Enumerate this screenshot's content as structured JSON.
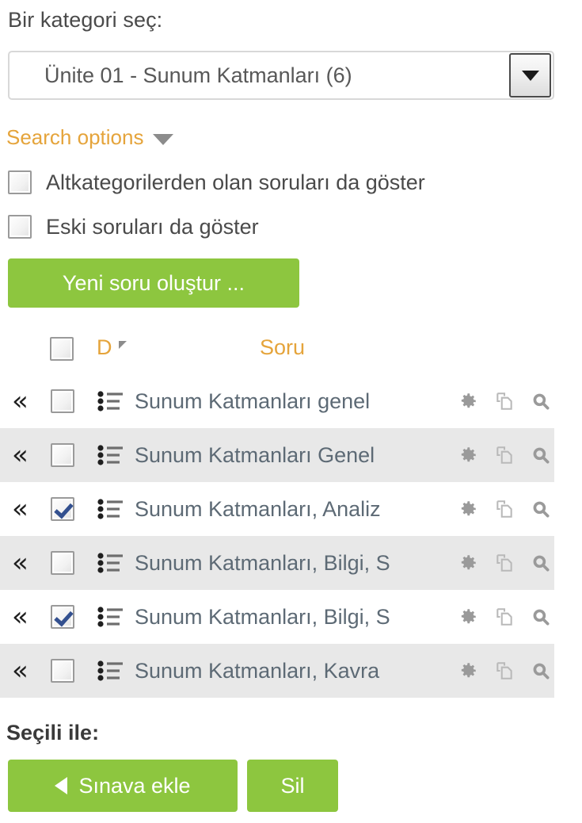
{
  "category": {
    "label": "Bir kategori seç:",
    "selected": "Ünite 01 - Sunum Katmanları (6)"
  },
  "search_options": {
    "label": "Search options",
    "caret_icon": "chevron-down-icon"
  },
  "options": [
    {
      "label": "Altkategorilerden olan soruları da göster",
      "checked": false
    },
    {
      "label": "Eski soruları da göster",
      "checked": false
    }
  ],
  "new_question_button": "Yeni soru oluştur ...",
  "table": {
    "headers": {
      "select_all": "",
      "d": "D",
      "sort_icon": "sort-ascending-icon",
      "soru": "Soru"
    },
    "rows": [
      {
        "name": "Sunum Katmanları genel ",
        "checked": false,
        "type_icon": "multichoice-icon",
        "move_icon": "double-chevron-left-icon"
      },
      {
        "name": "Sunum Katmanları Genel",
        "checked": false,
        "type_icon": "multichoice-icon",
        "move_icon": "double-chevron-left-icon"
      },
      {
        "name": "Sunum Katmanları, Analiz",
        "checked": true,
        "type_icon": "multichoice-icon",
        "move_icon": "double-chevron-left-icon"
      },
      {
        "name": "Sunum Katmanları, Bilgi, S",
        "checked": false,
        "type_icon": "multichoice-icon",
        "move_icon": "double-chevron-left-icon"
      },
      {
        "name": "Sunum Katmanları, Bilgi, S",
        "checked": true,
        "type_icon": "multichoice-icon",
        "move_icon": "double-chevron-left-icon"
      },
      {
        "name": "Sunum Katmanları, Kavra",
        "checked": false,
        "type_icon": "multichoice-icon",
        "move_icon": "double-chevron-left-icon"
      }
    ],
    "action_icons": [
      "gear-icon",
      "duplicate-icon",
      "magnifier-icon"
    ]
  },
  "footer": {
    "selected_with_label": "Seçili ile:",
    "add_to_quiz_button": "Sınava ekle",
    "delete_button": "Sil"
  },
  "colors": {
    "accent_orange": "#e5a43b",
    "green": "#8dc63f",
    "row_alt": "#e8e8e8",
    "text": "#4a4a4a",
    "question_text": "#5d6a75",
    "checkmark_blue": "#33508f"
  }
}
